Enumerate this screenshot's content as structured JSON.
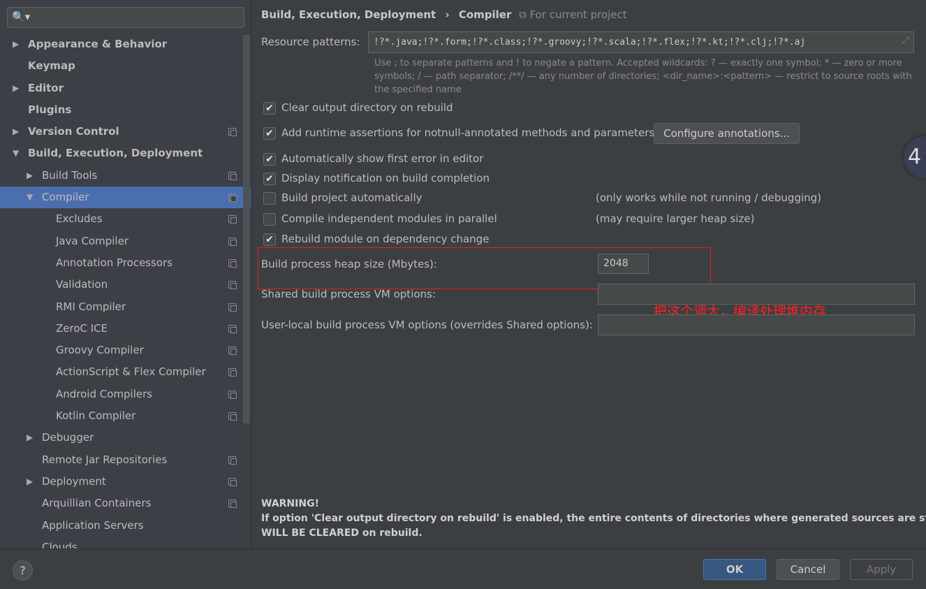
{
  "search": {
    "icon": "search-icon",
    "value": ""
  },
  "tree": [
    {
      "label": "Appearance & Behavior",
      "level": 0,
      "bold": true,
      "arrow": "right",
      "proj": false
    },
    {
      "label": "Keymap",
      "level": 0,
      "bold": true,
      "arrow": "",
      "proj": false
    },
    {
      "label": "Editor",
      "level": 0,
      "bold": true,
      "arrow": "right",
      "proj": false
    },
    {
      "label": "Plugins",
      "level": 0,
      "bold": true,
      "arrow": "",
      "proj": false
    },
    {
      "label": "Version Control",
      "level": 0,
      "bold": true,
      "arrow": "right",
      "proj": true
    },
    {
      "label": "Build, Execution, Deployment",
      "level": 0,
      "bold": true,
      "arrow": "down",
      "proj": false
    },
    {
      "label": "Build Tools",
      "level": 1,
      "bold": false,
      "arrow": "right",
      "proj": true
    },
    {
      "label": "Compiler",
      "level": 1,
      "bold": false,
      "arrow": "down",
      "proj": true,
      "selected": true
    },
    {
      "label": "Excludes",
      "level": 2,
      "bold": false,
      "arrow": "",
      "proj": true
    },
    {
      "label": "Java Compiler",
      "level": 2,
      "bold": false,
      "arrow": "",
      "proj": true
    },
    {
      "label": "Annotation Processors",
      "level": 2,
      "bold": false,
      "arrow": "",
      "proj": true
    },
    {
      "label": "Validation",
      "level": 2,
      "bold": false,
      "arrow": "",
      "proj": true
    },
    {
      "label": "RMI Compiler",
      "level": 2,
      "bold": false,
      "arrow": "",
      "proj": true
    },
    {
      "label": "ZeroC ICE",
      "level": 2,
      "bold": false,
      "arrow": "",
      "proj": true
    },
    {
      "label": "Groovy Compiler",
      "level": 2,
      "bold": false,
      "arrow": "",
      "proj": true
    },
    {
      "label": "ActionScript & Flex Compiler",
      "level": 2,
      "bold": false,
      "arrow": "",
      "proj": true
    },
    {
      "label": "Android Compilers",
      "level": 2,
      "bold": false,
      "arrow": "",
      "proj": true
    },
    {
      "label": "Kotlin Compiler",
      "level": 2,
      "bold": false,
      "arrow": "",
      "proj": true
    },
    {
      "label": "Debugger",
      "level": 1,
      "bold": false,
      "arrow": "right",
      "proj": false
    },
    {
      "label": "Remote Jar Repositories",
      "level": 1,
      "bold": false,
      "arrow": "",
      "proj": true
    },
    {
      "label": "Deployment",
      "level": 1,
      "bold": false,
      "arrow": "right",
      "proj": true
    },
    {
      "label": "Arquillian Containers",
      "level": 1,
      "bold": false,
      "arrow": "",
      "proj": true
    },
    {
      "label": "Application Servers",
      "level": 1,
      "bold": false,
      "arrow": "",
      "proj": false
    },
    {
      "label": "Clouds",
      "level": 1,
      "bold": false,
      "arrow": "",
      "proj": false
    }
  ],
  "header": {
    "crumb1": "Build, Execution, Deployment",
    "sep": "›",
    "crumb2": "Compiler",
    "project_icon": "project-icon",
    "project": "For current project"
  },
  "resource": {
    "label": "Resource patterns:",
    "value": "!?*.java;!?*.form;!?*.class;!?*.groovy;!?*.scala;!?*.flex;!?*.kt;!?*.clj;!?*.aj",
    "hint": "Use ; to separate patterns and ! to negate a pattern. Accepted wildcards: ? — exactly one symbol; * — zero or more symbols; / — path separator; /**/ — any number of directories; <dir_name>:<pattern> — restrict to source roots with the specified name"
  },
  "options": [
    {
      "label": "Clear output directory on rebuild",
      "checked": true,
      "note": ""
    },
    {
      "label": "Add runtime assertions for notnull-annotated methods and parameters",
      "checked": true,
      "note": ""
    },
    {
      "label": "Automatically show first error in editor",
      "checked": true,
      "note": ""
    },
    {
      "label": "Display notification on build completion",
      "checked": true,
      "note": ""
    },
    {
      "label": "Build project automatically",
      "checked": false,
      "note": "(only works while not running / debugging)"
    },
    {
      "label": "Compile independent modules in parallel",
      "checked": false,
      "note": "(may require larger heap size)"
    },
    {
      "label": "Rebuild module on dependency change",
      "checked": true,
      "note": ""
    }
  ],
  "configure_button": "Configure annotations...",
  "heap": {
    "label": "Build process heap size (Mbytes):",
    "value": "2048"
  },
  "shared_vm": {
    "label": "Shared build process VM options:",
    "value": ""
  },
  "local_vm": {
    "label": "User-local build process VM options (overrides Shared options):",
    "value": ""
  },
  "annotation": {
    "text": "把这个调大，编译处理堆内存",
    "color": "#ff2020"
  },
  "badge": "4",
  "warning": {
    "title": "WARNING!",
    "line1": "If option 'Clear output directory on rebuild' is enabled, the entire contents of directories where generated sources are stored",
    "line2": "WILL BE CLEARED on rebuild."
  },
  "footer": {
    "help": "?",
    "ok": "OK",
    "cancel": "Cancel",
    "apply": "Apply"
  },
  "colors": {
    "selection": "#4b6eaf",
    "ok": "#365880",
    "highlight_box": "#e02020"
  }
}
